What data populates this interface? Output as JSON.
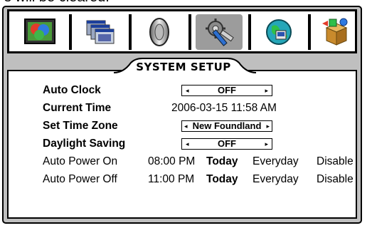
{
  "caption": "s will be cleared.",
  "toolbar": {
    "buttons": [
      {
        "icon": "display-color-icon"
      },
      {
        "icon": "windows-icon"
      },
      {
        "icon": "speaker-icon"
      },
      {
        "icon": "system-setup-tools-icon"
      },
      {
        "icon": "network-globe-icon"
      },
      {
        "icon": "installation-box-icon"
      }
    ],
    "selected_index": 3
  },
  "panel": {
    "title": "SYSTEM SETUP",
    "rows": {
      "auto_clock": {
        "label": "Auto Clock",
        "value": "OFF"
      },
      "current_time": {
        "label": "Current Time",
        "value": "2006-03-15  11:58  AM"
      },
      "time_zone": {
        "label": "Set Time Zone",
        "value": "New Foundland"
      },
      "daylight": {
        "label": "Daylight Saving",
        "value": "OFF"
      },
      "power_on": {
        "label": "Auto Power On",
        "time": "08:00 PM",
        "opt1": "Today",
        "opt2": "Everyday",
        "opt3": "Disable"
      },
      "power_off": {
        "label": "Auto Power Off",
        "time": "11:00 PM",
        "opt1": "Today",
        "opt2": "Everyday",
        "opt3": "Disable"
      }
    },
    "arrow_left": "◂",
    "arrow_right": "▸"
  },
  "colors": {
    "frame": "#bfbfbf",
    "selected": "#9c9c9c"
  }
}
